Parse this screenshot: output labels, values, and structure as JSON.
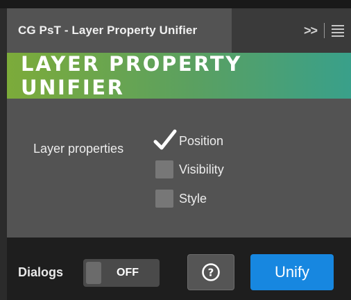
{
  "panel": {
    "tab_title": "CG PsT - Layer Property Unifier",
    "collapse_glyph": ">>",
    "banner_title": "LAYER PROPERTY UNIFIER"
  },
  "properties": {
    "label": "Layer properties",
    "options": [
      {
        "label": "Position",
        "checked": true
      },
      {
        "label": "Visibility",
        "checked": false
      },
      {
        "label": "Style",
        "checked": false
      }
    ]
  },
  "footer": {
    "dialogs_label": "Dialogs",
    "dialogs_toggle": "OFF",
    "help_glyph": "?",
    "unify_label": "Unify"
  },
  "colors": {
    "accent": "#1787e0",
    "banner_start": "#7cab3a",
    "banner_end": "#39a08a"
  },
  "icons": {
    "collapse": "double-chevron-right-icon",
    "menu": "hamburger-menu-icon",
    "help": "question-circle-icon",
    "check": "checkmark-icon"
  }
}
